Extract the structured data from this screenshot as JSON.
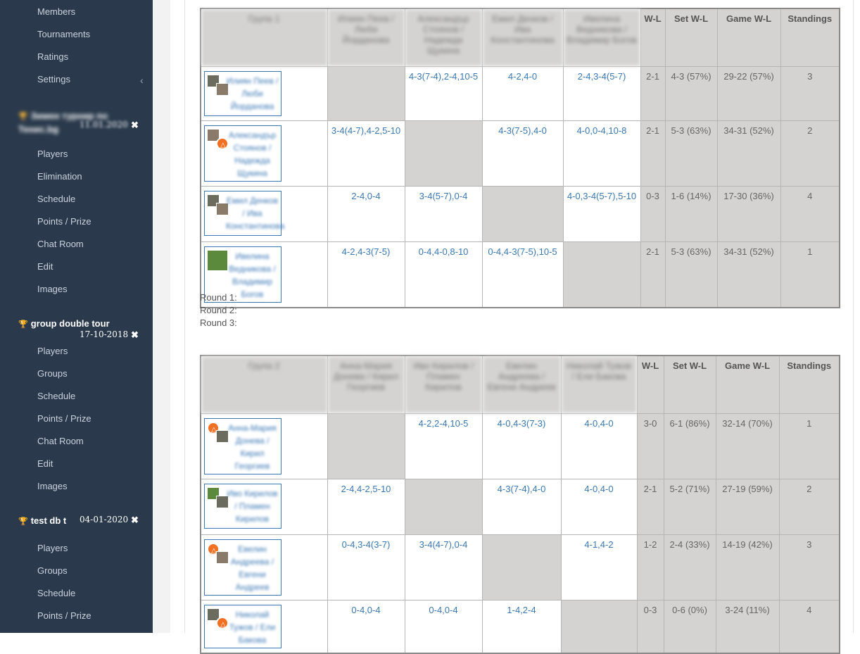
{
  "sidebar": {
    "items_top": [
      "Members",
      "Tournaments",
      "Ratings",
      "Settings"
    ],
    "tournament1": {
      "title": "Зимен турнир по Тенис.bg",
      "date": "11.01.2020",
      "items": [
        "Players",
        "Elimination",
        "Schedule",
        "Points / Prize",
        "Chat Room",
        "Edit",
        "Images"
      ]
    },
    "tournament2": {
      "title": "group double tour",
      "date": "17-10-2018",
      "items": [
        "Players",
        "Groups",
        "Schedule",
        "Points / Prize",
        "Chat Room",
        "Edit",
        "Images"
      ]
    },
    "tournament3": {
      "title": "test db t",
      "date": "04-01-2020",
      "items": [
        "Players",
        "Groups",
        "Schedule",
        "Points / Prize"
      ]
    }
  },
  "group1": {
    "name": "Група 1",
    "opponents": [
      "Илиян Пеев / Люби Йорданова",
      "Александър Стоянов / Надежда Щукина",
      "Емил Денков / Ива Константинова",
      "Ивелина Ведникова / Владимир Богов"
    ],
    "stat_headers": [
      "W-L",
      "Set W-L",
      "Game W-L",
      "Standings"
    ],
    "rows": [
      {
        "player": "Илиян Пеев / Люби Йорданова",
        "scores": [
          "",
          "4-3(7-4),2-4,10-5",
          "4-2,4-0",
          "2-4,3-4(5-7)"
        ],
        "wl": "2-1",
        "set": "4-3 (57%)",
        "game": "29-22 (57%)",
        "standing": "3"
      },
      {
        "player": "Александър Стоянов / Надежда Щукина",
        "scores": [
          "3-4(4-7),4-2,5-10",
          "",
          "4-3(7-5),4-0",
          "4-0,0-4,10-8"
        ],
        "wl": "2-1",
        "set": "5-3 (63%)",
        "game": "34-31 (52%)",
        "standing": "2"
      },
      {
        "player": "Емил Денков / Ива Константинова",
        "scores": [
          "2-4,0-4",
          "3-4(5-7),0-4",
          "",
          "4-0,3-4(5-7),5-10"
        ],
        "wl": "0-3",
        "set": "1-6 (14%)",
        "game": "17-30 (36%)",
        "standing": "4"
      },
      {
        "player": "Ивелина Ведникова / Владимир Богов",
        "scores": [
          "4-2,4-3(7-5)",
          "0-4,4-0,8-10",
          "0-4,4-3(7-5),10-5",
          ""
        ],
        "wl": "2-1",
        "set": "5-3 (63%)",
        "game": "34-31 (52%)",
        "standing": "1"
      }
    ]
  },
  "rounds": [
    "Round 1:",
    "Round 2:",
    "Round 3:"
  ],
  "group2": {
    "name": "Група 2",
    "opponents": [
      "Анна-Мария Донева / Кирил Георгиев",
      "Иво Кирилов / Пламен Кирилов",
      "Евелин Андреева / Евгени Андреев",
      "Николай Тужов / Ели Бакова"
    ],
    "stat_headers": [
      "W-L",
      "Set W-L",
      "Game W-L",
      "Standings"
    ],
    "rows": [
      {
        "player": "Анна-Мария Донева / Кирил Георгиев",
        "scores": [
          "",
          "4-2,2-4,10-5",
          "4-0,4-3(7-3)",
          "4-0,4-0"
        ],
        "wl": "3-0",
        "set": "6-1 (86%)",
        "game": "32-14 (70%)",
        "standing": "1"
      },
      {
        "player": "Иво Кирилов / Пламен Кирилов",
        "scores": [
          "2-4,4-2,5-10",
          "",
          "4-3(7-4),4-0",
          "4-0,4-0"
        ],
        "wl": "2-1",
        "set": "5-2 (71%)",
        "game": "27-19 (59%)",
        "standing": "2"
      },
      {
        "player": "Евелин Андреева / Евгени Андреев",
        "scores": [
          "0-4,3-4(3-7)",
          "3-4(4-7),0-4",
          "",
          "4-1,4-2"
        ],
        "wl": "1-2",
        "set": "2-4 (33%)",
        "game": "14-19 (42%)",
        "standing": "3"
      },
      {
        "player": "Николай Тужов / Ели Бакова",
        "scores": [
          "0-4,0-4",
          "0-4,0-4",
          "1-4,2-4",
          ""
        ],
        "wl": "0-3",
        "set": "0-6 (0%)",
        "game": "3-24 (11%)",
        "standing": "4"
      }
    ]
  }
}
